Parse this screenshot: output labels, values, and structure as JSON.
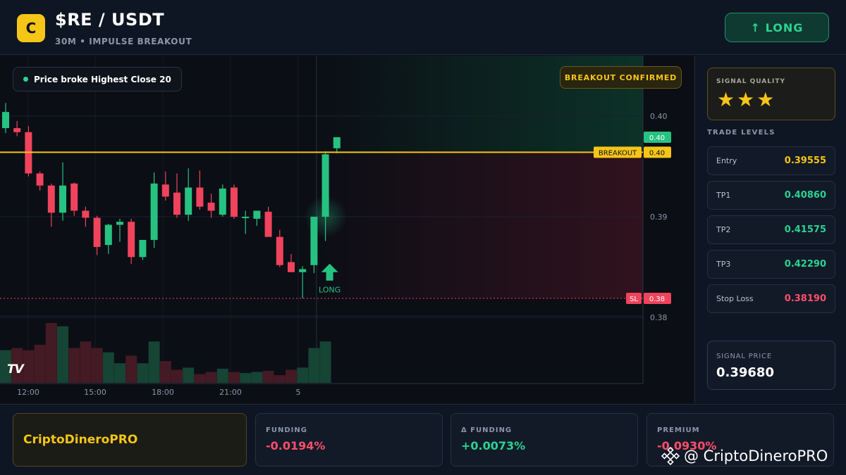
{
  "header": {
    "logo_letter": "C",
    "pair": "$RE / USDT",
    "subtitle": "30M • IMPULSE BREAKOUT",
    "action_label": "↑ LONG"
  },
  "chart": {
    "note_text": "Price broke Highest Close 20",
    "confirm_text": "BREAKOUT CONFIRMED",
    "tv_logo": "TV",
    "long_marker": "LONG",
    "price_labels": [
      "0.40",
      "0.39",
      "0.38"
    ],
    "time_labels": [
      "12:00",
      "15:00",
      "18:00",
      "21:00",
      "5"
    ],
    "breakout": {
      "label": "BREAKOUT",
      "value": "0.40"
    },
    "last_price": "0.40",
    "stop": {
      "label": "SL",
      "value": "0.38"
    }
  },
  "chart_data": {
    "type": "candlestick",
    "candles": [
      {
        "o": 0.3988,
        "h": 0.4013,
        "l": 0.3983,
        "c": 0.4004
      },
      {
        "o": 0.3988,
        "h": 0.3995,
        "l": 0.398,
        "c": 0.3984
      },
      {
        "o": 0.3984,
        "h": 0.399,
        "l": 0.394,
        "c": 0.3943
      },
      {
        "o": 0.3943,
        "h": 0.3945,
        "l": 0.3926,
        "c": 0.3931
      },
      {
        "o": 0.3931,
        "h": 0.3933,
        "l": 0.389,
        "c": 0.3904
      },
      {
        "o": 0.3904,
        "h": 0.3954,
        "l": 0.3896,
        "c": 0.3931
      },
      {
        "o": 0.3933,
        "h": 0.3934,
        "l": 0.3901,
        "c": 0.3906
      },
      {
        "o": 0.3906,
        "h": 0.391,
        "l": 0.389,
        "c": 0.3899
      },
      {
        "o": 0.3899,
        "h": 0.3901,
        "l": 0.3862,
        "c": 0.387
      },
      {
        "o": 0.3872,
        "h": 0.3893,
        "l": 0.3863,
        "c": 0.3892
      },
      {
        "o": 0.3892,
        "h": 0.3898,
        "l": 0.3875,
        "c": 0.3895
      },
      {
        "o": 0.3895,
        "h": 0.3898,
        "l": 0.3853,
        "c": 0.386
      },
      {
        "o": 0.386,
        "h": 0.3868,
        "l": 0.3857,
        "c": 0.3877
      },
      {
        "o": 0.3877,
        "h": 0.3944,
        "l": 0.3869,
        "c": 0.3933
      },
      {
        "o": 0.3932,
        "h": 0.3945,
        "l": 0.3916,
        "c": 0.392
      },
      {
        "o": 0.3924,
        "h": 0.3943,
        "l": 0.3899,
        "c": 0.3902
      },
      {
        "o": 0.3902,
        "h": 0.3948,
        "l": 0.3896,
        "c": 0.3929
      },
      {
        "o": 0.3929,
        "h": 0.3946,
        "l": 0.3907,
        "c": 0.391
      },
      {
        "o": 0.3914,
        "h": 0.3923,
        "l": 0.3899,
        "c": 0.3906
      },
      {
        "o": 0.3902,
        "h": 0.3932,
        "l": 0.39,
        "c": 0.3928
      },
      {
        "o": 0.3929,
        "h": 0.3932,
        "l": 0.3898,
        "c": 0.39
      },
      {
        "o": 0.3899,
        "h": 0.3906,
        "l": 0.3883,
        "c": 0.39
      },
      {
        "o": 0.3898,
        "h": 0.3904,
        "l": 0.3891,
        "c": 0.3906
      },
      {
        "o": 0.3905,
        "h": 0.391,
        "l": 0.388,
        "c": 0.388
      },
      {
        "o": 0.388,
        "h": 0.3887,
        "l": 0.385,
        "c": 0.3852
      },
      {
        "o": 0.3855,
        "h": 0.3863,
        "l": 0.3845,
        "c": 0.3845
      },
      {
        "o": 0.3845,
        "h": 0.3851,
        "l": 0.3819,
        "c": 0.3848
      },
      {
        "o": 0.3852,
        "h": 0.3854,
        "l": 0.3844,
        "c": 0.39
      },
      {
        "o": 0.39,
        "h": 0.3965,
        "l": 0.3876,
        "c": 0.3962
      },
      {
        "o": 0.3968,
        "h": 0.3979,
        "l": 0.3963,
        "c": 0.3979
      }
    ],
    "volumes": [
      0.3,
      0.32,
      0.3,
      0.35,
      0.55,
      0.52,
      0.32,
      0.38,
      0.32,
      0.28,
      0.18,
      0.25,
      0.18,
      0.38,
      0.2,
      0.12,
      0.14,
      0.08,
      0.1,
      0.13,
      0.1,
      0.09,
      0.1,
      0.11,
      0.07,
      0.12,
      0.14,
      0.32,
      0.38
    ],
    "ylim": [
      0.3805,
      0.406
    ],
    "breakout_level": 0.3964,
    "stop_level": 0.3819,
    "xlabel": "",
    "ylabel": ""
  },
  "panel": {
    "quality_label": "SIGNAL QUALITY",
    "stars": "★★★",
    "levels_title": "TRADE LEVELS",
    "levels": [
      {
        "name": "Entry",
        "value": "0.39555",
        "color": "#f5c518"
      },
      {
        "name": "TP1",
        "value": "0.40860",
        "color": "#2bd391"
      },
      {
        "name": "TP2",
        "value": "0.41575",
        "color": "#2bd391"
      },
      {
        "name": "TP3",
        "value": "0.42290",
        "color": "#2bd391"
      },
      {
        "name": "Stop Loss",
        "value": "0.38190",
        "color": "#ff4d6a"
      }
    ],
    "signal_price_label": "SIGNAL PRICE",
    "signal_price": "0.39680"
  },
  "footer": {
    "brand": "CriptoDineroPRO",
    "stats": [
      {
        "label": "FUNDING",
        "value": "-0.0194%",
        "color": "#ff4d6a"
      },
      {
        "label": "Δ FUNDING",
        "value": "+0.0073%",
        "color": "#2bd391"
      },
      {
        "label": "PREMIUM",
        "value": "-0.0930%",
        "color": "#ff4d6a"
      }
    ],
    "watermark": "@ CriptoDineroPRO"
  },
  "colors": {
    "up": "#26c281",
    "down": "#f0435c",
    "accent": "#f5c518"
  }
}
